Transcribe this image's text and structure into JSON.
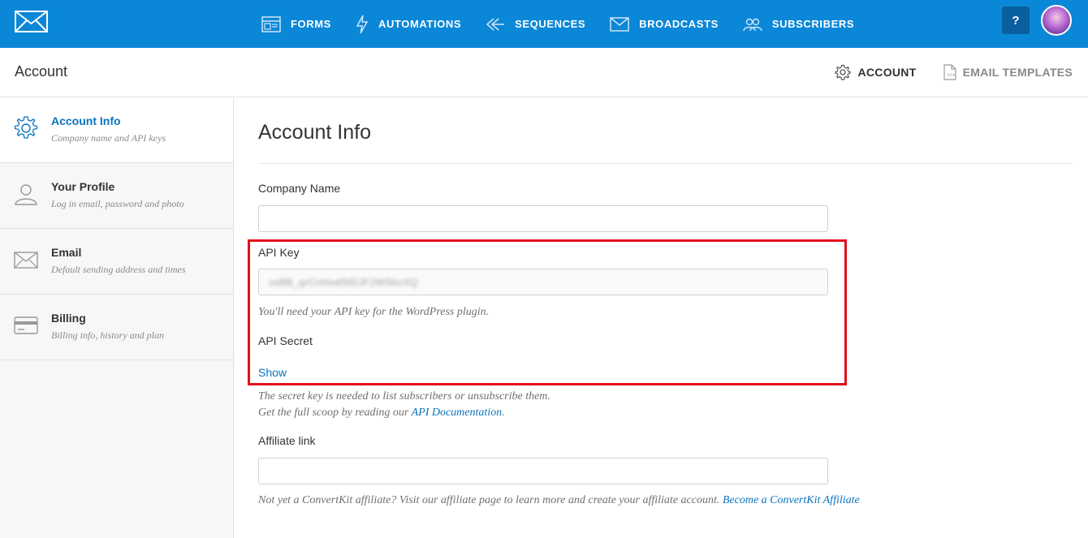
{
  "topnav": {
    "items": [
      {
        "label": "FORMS",
        "icon": "forms-icon"
      },
      {
        "label": "AUTOMATIONS",
        "icon": "lightning-icon"
      },
      {
        "label": "SEQUENCES",
        "icon": "sequences-icon"
      },
      {
        "label": "BROADCASTS",
        "icon": "envelope-icon"
      },
      {
        "label": "SUBSCRIBERS",
        "icon": "subscribers-icon"
      }
    ],
    "help_label": "?",
    "colors": {
      "bar": "#0b87d7",
      "help_button": "#0a5f9e"
    }
  },
  "subheader": {
    "title": "Account",
    "links": [
      {
        "label": "ACCOUNT",
        "icon": "gear-icon",
        "active": true
      },
      {
        "label": "EMAIL TEMPLATES",
        "icon": "document-icon",
        "active": false
      }
    ]
  },
  "sidebar": {
    "items": [
      {
        "label": "Account Info",
        "description": "Company name and API keys",
        "icon": "gear-icon",
        "active": true
      },
      {
        "label": "Your Profile",
        "description": "Log in email, password and photo",
        "icon": "person-icon",
        "active": false
      },
      {
        "label": "Email",
        "description": "Default sending address and times",
        "icon": "envelope-icon",
        "active": false
      },
      {
        "label": "Billing",
        "description": "Billing info, history and plan",
        "icon": "credit-card-icon",
        "active": false
      }
    ]
  },
  "main": {
    "title": "Account Info",
    "company_name": {
      "label": "Company Name",
      "value": ""
    },
    "api_key": {
      "label": "API Key",
      "value": "xxBB_qrCnhlvdSlDJF2WSkoXQ",
      "hint": "You'll need your API key for the WordPress plugin."
    },
    "api_secret": {
      "label": "API Secret",
      "show_label": "Show",
      "hint_line1": "The secret key is needed to list subscribers or unsubscribe them.",
      "hint_line2_prefix": "Get the full scoop by reading our ",
      "hint_line2_link": "API Documentation",
      "hint_line2_suffix": "."
    },
    "affiliate": {
      "label": "Affiliate link",
      "value": "",
      "hint_prefix": "Not yet a ConvertKit affiliate? Visit our affiliate page to learn more and create your affiliate account. ",
      "hint_link": "Become a ConvertKit Affiliate"
    },
    "colors": {
      "link": "#0b74bd",
      "highlight_box": "#e3101a"
    }
  }
}
